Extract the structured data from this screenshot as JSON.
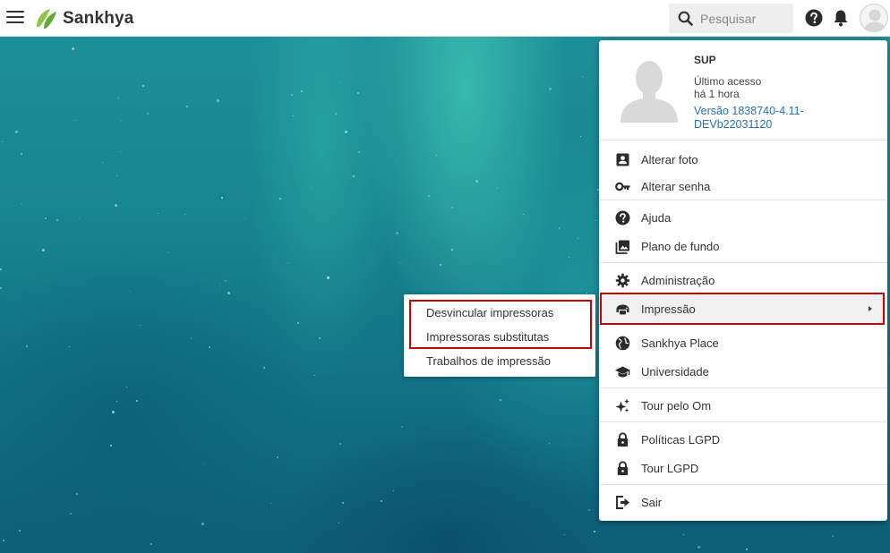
{
  "app": {
    "brand": "Sankhya",
    "brand_color": "#7cbf3b"
  },
  "search": {
    "placeholder": "Pesquisar"
  },
  "topbar_icons": [
    "menu-icon",
    "search-icon",
    "help-icon",
    "bell-icon",
    "avatar"
  ],
  "profile": {
    "user": "SUP",
    "last_access": "Último acesso",
    "last_access_when": "há 1 hora",
    "version_line1": "Versão 1838740-4.11-",
    "version_line2": "DEVb22031120"
  },
  "menu": {
    "items": [
      {
        "label": "Alterar foto",
        "icon": "contact-card-icon"
      },
      {
        "label": "Alterar senha",
        "icon": "key-icon"
      },
      {
        "label": "Ajuda",
        "icon": "help-icon"
      },
      {
        "label": "Plano de fundo",
        "icon": "image-icon"
      },
      {
        "label": "Administração",
        "icon": "gear-icon"
      },
      {
        "label": "Impressão",
        "icon": "printer-icon",
        "has_submenu": true,
        "highlighted": true
      },
      {
        "label": "Sankhya Place",
        "icon": "globe-icon"
      },
      {
        "label": "Universidade",
        "icon": "graduation-cap-icon"
      },
      {
        "label": "Tour pelo Om",
        "icon": "sparkle-icon"
      },
      {
        "label": "Políticas LGPD",
        "icon": "lock-icon"
      },
      {
        "label": "Tour LGPD",
        "icon": "lock-icon"
      },
      {
        "label": "Sair",
        "icon": "logout-icon"
      }
    ]
  },
  "submenu": {
    "items": [
      {
        "label": "Desvincular impressoras",
        "highlighted": true
      },
      {
        "label": "Impressoras substitutas",
        "highlighted": true
      },
      {
        "label": "Trabalhos de impressão"
      }
    ]
  },
  "colors": {
    "highlight": "#cc0000",
    "link": "#2770b3",
    "icon": "#2b2b2b"
  }
}
